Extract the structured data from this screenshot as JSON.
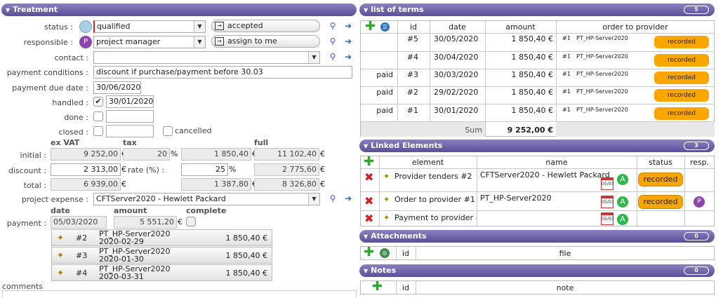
{
  "treatment": {
    "title": "Treatment",
    "status_label": "status :",
    "status_value": "qualified",
    "status_action": "accepted",
    "responsible_label": "responsible :",
    "responsible_value": "project manager",
    "responsible_action": "assign to me",
    "contact_label": "contact :",
    "contact_value": "",
    "payment_conditions_label": "payment conditions :",
    "payment_conditions_value": "discount if purchase/payment before 30.03",
    "payment_due_label": "payment due date :",
    "payment_due_value": "30/06/2020",
    "handled_label": "handled :",
    "handled_value": "30/01/2020",
    "done_label": "done :",
    "closed_label": "closed :",
    "cancelled_label": "cancelled",
    "col_exvat": "ex VAT",
    "col_tax": "tax",
    "col_full": "full",
    "initial_label": "initial :",
    "initial_exvat": "9 252,00",
    "initial_rate": "20",
    "initial_tax": "1 850,40",
    "initial_full": "11 102,40",
    "discount_label": "discount :",
    "discount_exvat": "2 313,00",
    "rate_label": "rate (%) :",
    "rate_value": "25",
    "discount_full": "2 775,60",
    "total_label": "total :",
    "total_exvat": "6 939,00",
    "total_tax": "1 387,80",
    "total_full": "8 326,80",
    "currency": "€",
    "percent": "%",
    "project_expense_label": "project expense :",
    "project_expense_value": "CFTServer2020 - Hewlett Packard",
    "col_date": "date",
    "col_amount": "amount",
    "col_complete": "complete",
    "payment_label": "payment :",
    "payment_date": "05/03/2020",
    "payment_amount": "5 551,20",
    "payments": [
      {
        "id": "#2",
        "name": "PT_HP-Server2020",
        "date": "2020-02-29",
        "amount": "1 850,40 €"
      },
      {
        "id": "#3",
        "name": "PT_HP-Server2020",
        "date": "2020-01-30",
        "amount": "1 850,40 €"
      },
      {
        "id": "#4",
        "name": "PT_HP-Server2020",
        "date": "2020-03-31",
        "amount": "1 850,40 €"
      }
    ],
    "comments_label": "comments"
  },
  "terms": {
    "title": "list of terms",
    "count": "5",
    "headers": {
      "id": "id",
      "date": "date",
      "amount": "amount",
      "order": "order to provider"
    },
    "rows": [
      {
        "paid": "",
        "id": "#5",
        "date": "30/05/2020",
        "amount": "1 850,40 €",
        "order_id": "#1",
        "order_name": "PT_HP-Server2020",
        "status": "recorded"
      },
      {
        "paid": "",
        "id": "#4",
        "date": "30/04/2020",
        "amount": "1 850,40 €",
        "order_id": "#1",
        "order_name": "PT_HP-Server2020",
        "status": "recorded"
      },
      {
        "paid": "paid",
        "id": "#3",
        "date": "30/03/2020",
        "amount": "1 850,40 €",
        "order_id": "#1",
        "order_name": "PT_HP-Server2020",
        "status": "recorded"
      },
      {
        "paid": "paid",
        "id": "#2",
        "date": "29/02/2020",
        "amount": "1 850,40 €",
        "order_id": "#1",
        "order_name": "PT_HP-Server2020",
        "status": "recorded"
      },
      {
        "paid": "paid",
        "id": "#1",
        "date": "30/01/2020",
        "amount": "1 850,40 €",
        "order_id": "#1",
        "order_name": "PT_HP-Server2020",
        "status": "recorded"
      }
    ],
    "sum_label": "Sum",
    "sum_value": "9 252,00 €"
  },
  "linked": {
    "title": "Linked Elements",
    "count": "3",
    "headers": {
      "element": "element",
      "name": "name",
      "status": "status",
      "resp": "resp."
    },
    "rows": [
      {
        "element": "Provider tenders #2",
        "name": "CFTServer2020 - Hewlett Packard",
        "cal": "05/03",
        "badge": "A",
        "status": "recorded",
        "resp": ""
      },
      {
        "element": "Order to provider #1",
        "name": "PT_HP-Server2020",
        "cal": "05/03",
        "badge": "A",
        "status": "recorded",
        "resp": "P"
      },
      {
        "element": "Payment to provider #",
        "name": "",
        "cal": "05/03",
        "badge": "A",
        "status": "",
        "resp": ""
      }
    ]
  },
  "attachments": {
    "title": "Attachments",
    "count": "0",
    "headers": {
      "id": "id",
      "file": "file"
    }
  },
  "notes": {
    "title": "Notes",
    "count": "0",
    "headers": {
      "id": "id",
      "note": "note"
    }
  },
  "colors": {
    "header": "#6a5fa8",
    "status_orange": "#f9a600",
    "badge_green": "#2db84a",
    "badge_purple": "#8e44ad"
  }
}
